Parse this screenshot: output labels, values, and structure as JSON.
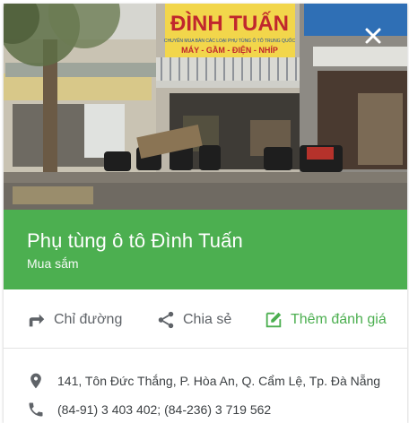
{
  "photo": {
    "alt": "",
    "shop_sign_main": "ĐÌNH TUẤN",
    "shop_sign_sub": "CHUYÊN MUA BÁN CÁC LOẠI PHỤ TÙNG Ô TÔ TRUNG QUỐC",
    "shop_sign_line2": "MÁY - GẦM - ĐIỆN - NHÍP"
  },
  "close": {
    "icon": "close-icon"
  },
  "place": {
    "name": "Phụ tùng ô tô Đình Tuấn",
    "category": "Mua sắm"
  },
  "actions": {
    "directions": {
      "label": "Chỉ đường",
      "icon": "directions-icon"
    },
    "share": {
      "label": "Chia sẻ",
      "icon": "share-icon"
    },
    "review": {
      "label": "Thêm đánh giá",
      "icon": "edit-review-icon"
    }
  },
  "info": {
    "address": {
      "text": "141, Tôn Đức Thắng, P. Hòa An, Q. Cẩm Lệ, Tp. Đà Nẵng",
      "icon": "location-pin-icon"
    },
    "phone": {
      "text": "(84-91) 3 403 402; (84-236) 3 719 562",
      "icon": "phone-icon"
    }
  },
  "colors": {
    "accent_green": "#4caf50",
    "text_gray": "#5f6368"
  }
}
